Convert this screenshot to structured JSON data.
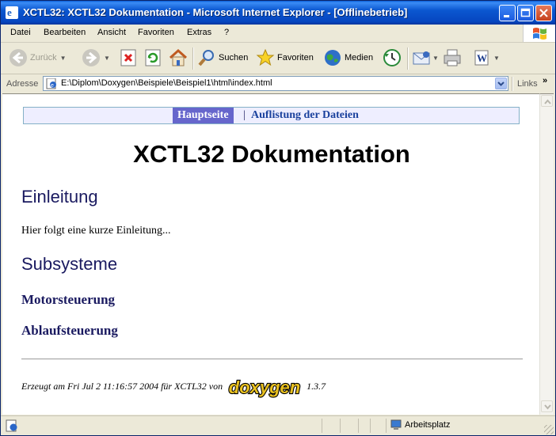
{
  "window": {
    "title": "XCTL32: XCTL32 Dokumentation - Microsoft Internet Explorer - [Offlinebetrieb]"
  },
  "menu": [
    "Datei",
    "Bearbeiten",
    "Ansicht",
    "Favoriten",
    "Extras",
    "?"
  ],
  "toolbar": {
    "back_label": "Zurück",
    "search_label": "Suchen",
    "favorites_label": "Favoriten",
    "media_label": "Medien"
  },
  "address": {
    "label": "Adresse",
    "url": "E:\\Diplom\\Doxygen\\Beispiele\\Beispiel1\\html\\index.html",
    "links_label": "Links",
    "links_chevron": "»"
  },
  "page": {
    "nav_current": "Hauptseite",
    "nav_separator": "|",
    "nav_link": "Auflistung der Dateien",
    "title": "XCTL32 Dokumentation",
    "section1_heading": "Einleitung",
    "section1_text": "Hier folgt eine kurze Einleitung...",
    "section2_heading": "Subsysteme",
    "sub1_heading": "Motorsteuerung",
    "sub2_heading": "Ablaufsteuerung",
    "footer_prefix": "Erzeugt am Fri Jul 2 11:16:57 2004 für XCTL32 von",
    "footer_logo_text": "doxygen",
    "footer_version": "1.3.7"
  },
  "status": {
    "zone": "Arbeitsplatz"
  }
}
